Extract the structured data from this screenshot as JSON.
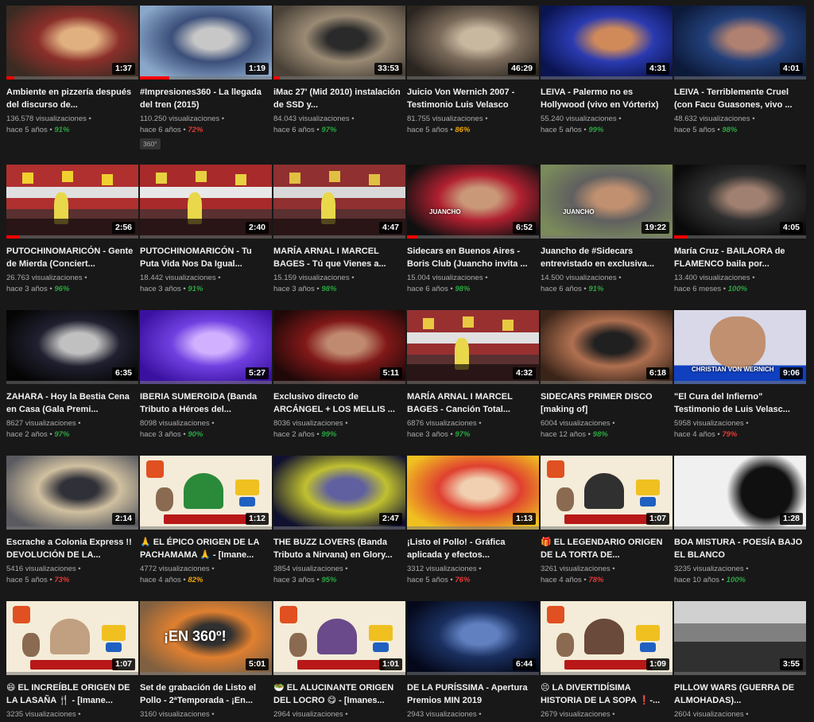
{
  "colors": {
    "background": "#181818",
    "progress": "#ff0000",
    "pct_high": "#2ba640",
    "pct_mid": "#f0a400",
    "pct_low": "#e53935"
  },
  "videos": [
    {
      "title": "Ambiente en pizzería después del discurso de...",
      "duration": "1:37",
      "views": "136.578 visualizaciones •",
      "age": "hace 5 años •",
      "pct": "91%",
      "level": "high",
      "progress": 0.06,
      "thumb": "crowd",
      "colors": [
        "#3a2b22",
        "#8b2f2a",
        "#e0b080"
      ]
    },
    {
      "title": "#Impresiones360 - La llegada del tren (2015)",
      "duration": "1:19",
      "views": "110.250 visualizaciones •",
      "age": "hace 6 años •",
      "pct": "72%",
      "level": "low",
      "progress": 0.22,
      "thumb": "train",
      "colors": [
        "#8aa7c9",
        "#3b4f7a",
        "#c7c7c7"
      ],
      "badge": "360°"
    },
    {
      "title": "iMac 27' (Mid 2010) instalación de SSD y...",
      "duration": "33:53",
      "views": "84.043 visualizaciones •",
      "age": "hace 6 años •",
      "pct": "97%",
      "level": "high",
      "progress": 0.05,
      "thumb": "desk",
      "colors": [
        "#4a4238",
        "#9a8a74",
        "#2a2a2a"
      ]
    },
    {
      "title": "Juicio Von Wernich 2007 - Testimonio Luis Velasco",
      "duration": "46:29",
      "views": "81.755 visualizaciones •",
      "age": "hace 5 años •",
      "pct": "86%",
      "level": "mid",
      "progress": 0.0,
      "thumb": "people",
      "colors": [
        "#2b2520",
        "#7a6a5a",
        "#c8b8a0"
      ]
    },
    {
      "title": "LEIVA - Palermo no es Hollywood (vivo en Vórterix)",
      "duration": "4:31",
      "views": "55.240 visualizaciones •",
      "age": "hace 5 años •",
      "pct": "99%",
      "level": "high",
      "progress": 0.0,
      "thumb": "stage-blue",
      "colors": [
        "#0a1450",
        "#2a3ab0",
        "#d08a5a"
      ]
    },
    {
      "title": "LEIVA - Terriblemente Cruel (con Facu Guasones, vivo ...",
      "duration": "4:01",
      "views": "48.632 visualizaciones •",
      "age": "hace 5 años •",
      "pct": "98%",
      "level": "high",
      "progress": 0.0,
      "thumb": "stage-blue",
      "colors": [
        "#0c1a3a",
        "#23407a",
        "#b08070"
      ]
    },
    {
      "title": "PUTOCHINOMARICÓN - Gente de Mierda (Conciert...",
      "duration": "2:56",
      "views": "26.763 visualizaciones •",
      "age": "hace 3 años •",
      "pct": "96%",
      "level": "high",
      "progress": 0.1,
      "thumb": "market",
      "colors": [
        "#b03030",
        "#e0e0e0",
        "#f0d030"
      ]
    },
    {
      "title": "PUTOCHINOMARICÓN - Tu Puta Vida Nos Da Igual...",
      "duration": "2:40",
      "views": "18.442 visualizaciones •",
      "age": "hace 3 años •",
      "pct": "91%",
      "level": "high",
      "progress": 0.0,
      "thumb": "market",
      "colors": [
        "#a82a2a",
        "#e8e8e8",
        "#e8d040"
      ]
    },
    {
      "title": "MARÍA ARNAL I MARCEL BAGES - Tú que Vienes a...",
      "duration": "4:47",
      "views": "15.159 visualizaciones •",
      "age": "hace 3 años •",
      "pct": "98%",
      "level": "high",
      "progress": 0.0,
      "thumb": "market",
      "colors": [
        "#903030",
        "#d8d8d8",
        "#e0c040"
      ]
    },
    {
      "title": "Sidecars en Buenos Aires - Boris Club (Juancho invita ...",
      "duration": "6:52",
      "views": "15.004 visualizaciones •",
      "age": "hace 6 años •",
      "pct": "98%",
      "level": "high",
      "progress": 0.08,
      "thumb": "interview",
      "colors": [
        "#101010",
        "#b02030",
        "#c89878"
      ],
      "overlay": "JUANCHO"
    },
    {
      "title": "Juancho de #Sidecars entrevistado en exclusiva...",
      "duration": "19:22",
      "views": "14.500 visualizaciones •",
      "age": "hace 6 años •",
      "pct": "91%",
      "level": "high",
      "progress": 0.0,
      "thumb": "interview2",
      "colors": [
        "#7a8a5a",
        "#606060",
        "#c09070"
      ],
      "overlay": "JUANCHO"
    },
    {
      "title": "María Cruz - BAILAORA de FLAMENCO baila por...",
      "duration": "4:05",
      "views": "13.400 visualizaciones •",
      "age": "hace 6 meses •",
      "pct": "100%",
      "level": "high",
      "progress": 0.1,
      "thumb": "dark-dancer",
      "colors": [
        "#0a0a0a",
        "#303030",
        "#a08070"
      ]
    },
    {
      "title": "ZAHARA - Hoy la Bestia Cena en Casa (Gala Premi...",
      "duration": "6:35",
      "views": "8627 visualizaciones •",
      "age": "hace 2 años •",
      "pct": "97%",
      "level": "high",
      "progress": 0.0,
      "thumb": "dark-stage",
      "colors": [
        "#050505",
        "#202030",
        "#c0c0c0"
      ]
    },
    {
      "title": "IBERIA SUMERGIDA (Banda Tributo a Héroes del...",
      "duration": "5:27",
      "views": "8098 visualizaciones •",
      "age": "hace 3 años •",
      "pct": "90%",
      "level": "high",
      "progress": 0.0,
      "thumb": "purple-stage",
      "colors": [
        "#3a10a0",
        "#7040e0",
        "#d0b0ff"
      ]
    },
    {
      "title": "Exclusivo directo de ARCÁNGEL + LOS MELLIS ...",
      "duration": "5:11",
      "views": "8036 visualizaciones •",
      "age": "hace 2 años •",
      "pct": "99%",
      "level": "high",
      "progress": 0.0,
      "thumb": "red-stage",
      "colors": [
        "#200808",
        "#801818",
        "#c08a70"
      ]
    },
    {
      "title": "MARÍA ARNAL I MARCEL BAGES - Canción Total...",
      "duration": "4:32",
      "views": "6876 visualizaciones •",
      "age": "hace 3 años •",
      "pct": "97%",
      "level": "high",
      "progress": 0.0,
      "thumb": "market",
      "colors": [
        "#983030",
        "#e0e0e0",
        "#e8c840"
      ]
    },
    {
      "title": "SIDECARS PRIMER DISCO [making of]",
      "duration": "6:18",
      "views": "6004 visualizaciones •",
      "age": "hace 12 años •",
      "pct": "98%",
      "level": "high",
      "progress": 0.0,
      "thumb": "closeup",
      "colors": [
        "#3a2418",
        "#b07050",
        "#202020"
      ]
    },
    {
      "title": "\"El Cura del Infierno\" Testimonio de Luis Velasc...",
      "duration": "9:06",
      "views": "5958 visualizaciones •",
      "age": "hace 4 años •",
      "pct": "79%",
      "level": "low",
      "progress": 0.0,
      "thumb": "tv",
      "colors": [
        "#d8d8e8",
        "#c09070",
        "#1040c0"
      ],
      "overlay": "CHRISTIAN VON WERNICH"
    },
    {
      "title": "Escrache a Colonia Express !! DEVOLUCIÓN DE LA...",
      "duration": "2:14",
      "views": "5416 visualizaciones •",
      "age": "hace 5 años •",
      "pct": "73%",
      "level": "low",
      "progress": 0.0,
      "thumb": "street",
      "colors": [
        "#5a5a60",
        "#d0c0a0",
        "#303038"
      ]
    },
    {
      "title": "🙏 EL ÉPICO ORIGEN DE LA PACHAMAMA 🙏 - [Imane...",
      "duration": "1:12",
      "views": "4772 visualizaciones •",
      "age": "hace 4 años •",
      "pct": "82%",
      "level": "mid",
      "progress": 0.0,
      "thumb": "cartoon",
      "colors": [
        "#f4ecd8",
        "#2a8a3a",
        "#e05020"
      ]
    },
    {
      "title": "THE BUZZ LOVERS (Banda Tributo a Nirvana) en Glory...",
      "duration": "2:47",
      "views": "3854 visualizaciones •",
      "age": "hace 3 años •",
      "pct": "95%",
      "level": "high",
      "progress": 0.0,
      "thumb": "spot-stage",
      "colors": [
        "#101030",
        "#c0c030",
        "#6060a0"
      ]
    },
    {
      "title": "¡Listo el Pollo! - Gráfica aplicada y efectos...",
      "duration": "1:13",
      "views": "3312 visualizaciones •",
      "age": "hace 5 años •",
      "pct": "76%",
      "level": "low",
      "progress": 0.0,
      "thumb": "kids",
      "colors": [
        "#f0c020",
        "#e04030",
        "#f0d0b0"
      ]
    },
    {
      "title": "🎁 EL LEGENDARIO ORIGEN DE LA TORTA DE...",
      "duration": "1:07",
      "views": "3261 visualizaciones •",
      "age": "hace 4 años •",
      "pct": "78%",
      "level": "low",
      "progress": 0.0,
      "thumb": "cartoon",
      "colors": [
        "#f4ecd8",
        "#303030",
        "#e05020"
      ]
    },
    {
      "title": "BOA MISTURA - POESÍA BAJO EL BLANCO",
      "duration": "1:28",
      "views": "3235 visualizaciones •",
      "age": "hace 10 años •",
      "pct": "100%",
      "level": "high",
      "progress": 0.0,
      "thumb": "bw",
      "colors": [
        "#f0f0f0",
        "#101010",
        "#808080"
      ]
    },
    {
      "title": "😄 EL INCREÍBLE ORIGEN DE LA LASAÑA 🍴 - [Imane...",
      "duration": "1:07",
      "views": "3235 visualizaciones •",
      "age": "",
      "pct": "",
      "level": "high",
      "progress": 0.0,
      "thumb": "cartoon",
      "colors": [
        "#f4ecd8",
        "#c0a080",
        "#e05020"
      ]
    },
    {
      "title": "Set de grabación de Listo el Pollo - 2ªTemporada - ¡En...",
      "duration": "5:01",
      "views": "3160 visualizaciones •",
      "age": "",
      "pct": "",
      "level": "high",
      "progress": 0.0,
      "thumb": "set360",
      "colors": [
        "#806040",
        "#e08030",
        "#303030"
      ],
      "overlay": "¡EN 360º!"
    },
    {
      "title": "🥗 EL ALUCINANTE ORIGEN DEL LOCRO 😋 - [Imanes...",
      "duration": "1:01",
      "views": "2964 visualizaciones •",
      "age": "",
      "pct": "",
      "level": "high",
      "progress": 0.0,
      "thumb": "cartoon",
      "colors": [
        "#f4ecd8",
        "#6a4a8a",
        "#e05020"
      ]
    },
    {
      "title": "DE LA PURÍSSIMA - Apertura Premios MIN 2019",
      "duration": "6:44",
      "views": "2943 visualizaciones •",
      "age": "",
      "pct": "",
      "level": "high",
      "progress": 0.0,
      "thumb": "dark-blue",
      "colors": [
        "#04081a",
        "#1a3060",
        "#6080c0"
      ]
    },
    {
      "title": "😣 LA DIVERTIDÍSIMA HISTORIA DE LA SOPA ❗-...",
      "duration": "1:09",
      "views": "2679 visualizaciones •",
      "age": "",
      "pct": "",
      "level": "high",
      "progress": 0.0,
      "thumb": "cartoon",
      "colors": [
        "#f4ecd8",
        "#6a4a3a",
        "#e05020"
      ]
    },
    {
      "title": "PILLOW WARS (GUERRA DE ALMOHADAS)...",
      "duration": "3:55",
      "views": "2604 visualizaciones •",
      "age": "",
      "pct": "",
      "level": "high",
      "progress": 0.0,
      "thumb": "bw-crowd",
      "colors": [
        "#d0d0d0",
        "#303030",
        "#808080"
      ]
    }
  ]
}
